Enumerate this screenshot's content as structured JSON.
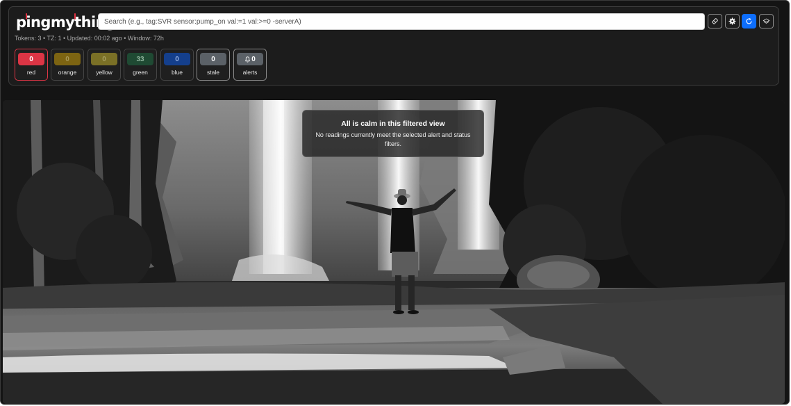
{
  "app": {
    "brand": "pingmything"
  },
  "search": {
    "placeholder": "Search (e.g., tag:SVR sensor:pump_on val:=1 val:>=0 -serverA)",
    "value": ""
  },
  "toolbar": {
    "buttons": [
      {
        "name": "eraser-button",
        "icon": "eraser-icon"
      },
      {
        "name": "settings-button",
        "icon": "gear-icon"
      },
      {
        "name": "refresh-button",
        "icon": "refresh-icon",
        "color": "#0d6efd"
      },
      {
        "name": "layers-button",
        "icon": "layers-icon"
      }
    ]
  },
  "meta": {
    "status_line": "Tokens: 3 • TZ: 1 • Updated: 00:02 ago • Window: 72h"
  },
  "filters": [
    {
      "key": "red",
      "count": "0",
      "label": "red",
      "pill_bg": "#dc3545",
      "pill_fg": "#ffffff",
      "active": true
    },
    {
      "key": "orange",
      "count": "0",
      "label": "orange",
      "pill_bg": "#7d6412",
      "pill_fg": "#a89858"
    },
    {
      "key": "yellow",
      "count": "0",
      "label": "yellow",
      "pill_bg": "#7a7026",
      "pill_fg": "#a69f62"
    },
    {
      "key": "green",
      "count": "33",
      "label": "green",
      "pill_bg": "#1f4a33",
      "pill_fg": "#8fb39c"
    },
    {
      "key": "blue",
      "count": "0",
      "label": "blue",
      "pill_bg": "#143f8c",
      "pill_fg": "#93aee0"
    },
    {
      "key": "stale",
      "count": "0",
      "label": "stale",
      "pill_bg": "#5b6167",
      "pill_fg": "#ffffff"
    },
    {
      "key": "alerts",
      "count": "0",
      "label": "alerts",
      "pill_bg": "#5b6167",
      "pill_fg": "#ffffff",
      "icon": "bell-icon"
    }
  ],
  "notice": {
    "title": "All is calm in this filtered view",
    "message": "No readings currently meet the selected alert and status filters."
  },
  "background": {
    "subject": "waterfall-photo",
    "palette": "grayscale"
  }
}
